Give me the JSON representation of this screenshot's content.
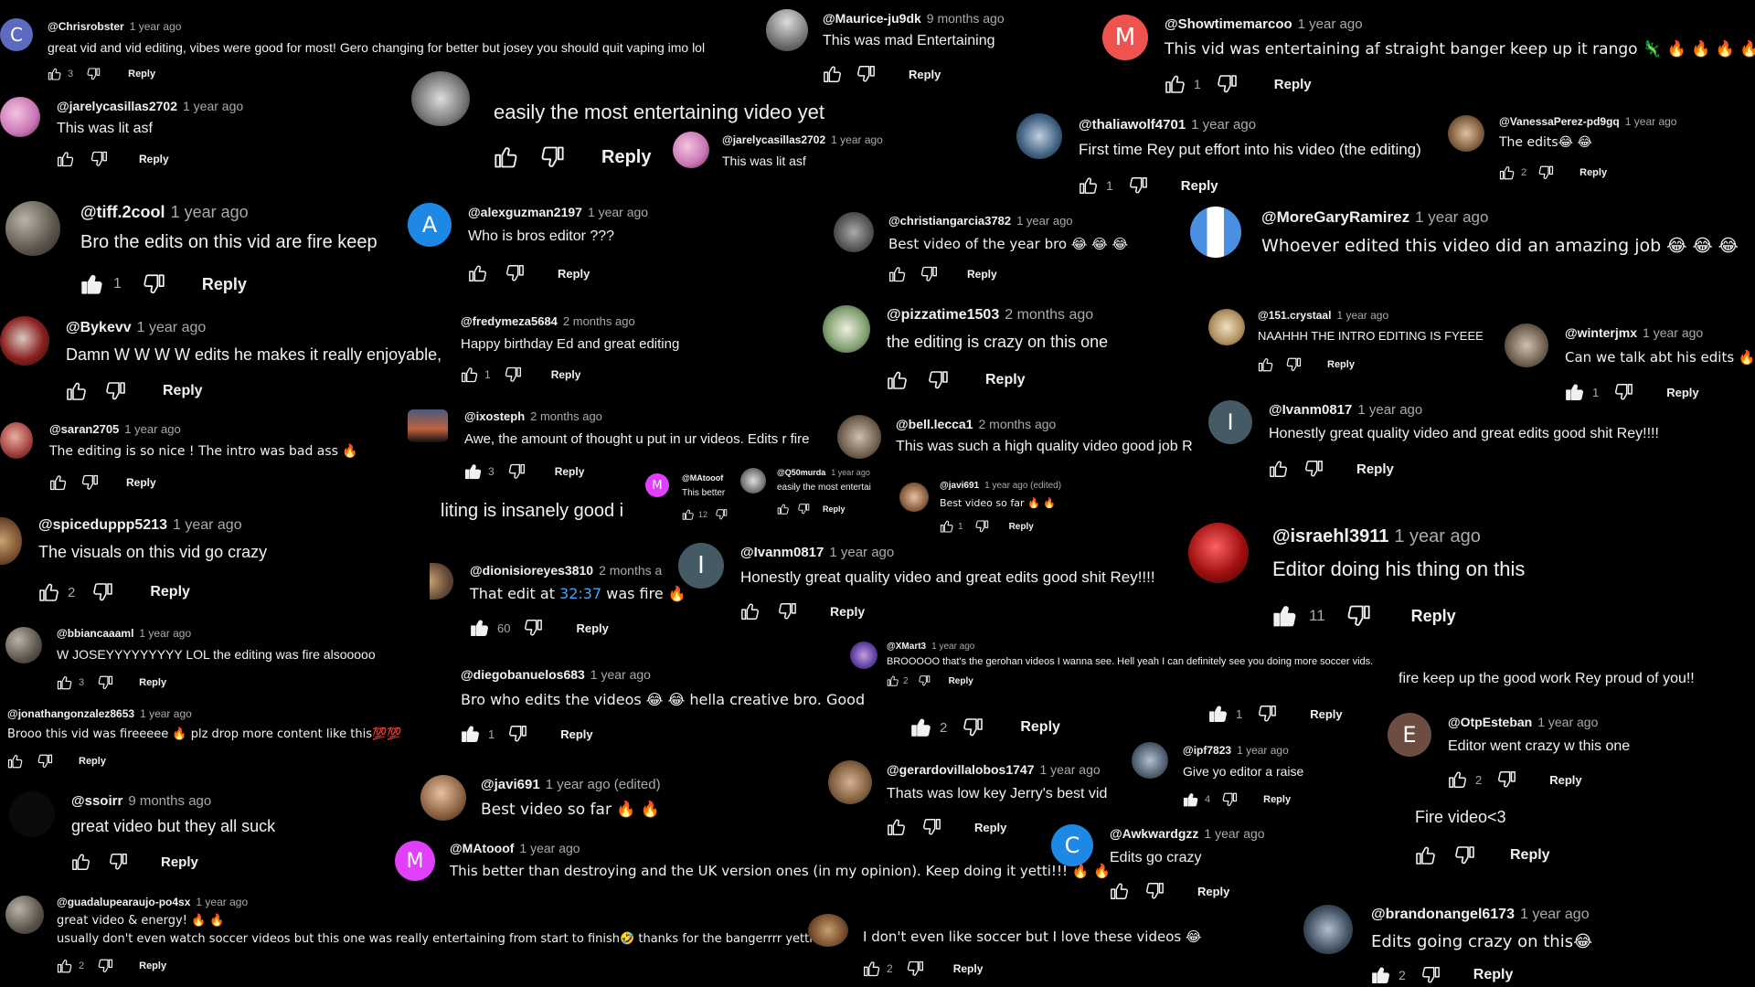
{
  "icons": {
    "like": "thumbs-up-icon",
    "dislike": "thumbs-down-icon"
  },
  "colors": {
    "background": "#000000",
    "username": "#f1f1f1",
    "timestamp": "#aaaaaa",
    "link": "#3ea6ff"
  },
  "comments": [
    {
      "id": "c1",
      "avatar_letter": "C",
      "user": "@Chrisrobster",
      "time": "1 year ago",
      "text": "great vid and vid editing, vibes were good for most! Gero changing for better but josey you should quit vaping imo lol",
      "likes": "3",
      "reply": "Reply"
    },
    {
      "id": "c2",
      "user": "@jarelycasillas2702",
      "time": "1 year ago",
      "text": "This was lit asf",
      "likes": "",
      "reply": "Reply"
    },
    {
      "id": "c3",
      "user": "@tiff.2cool",
      "time": "1 year ago",
      "text": "Bro the edits on this vid are fire keep",
      "likes": "1",
      "reply": "Reply"
    },
    {
      "id": "c4",
      "user": "@Bykevv",
      "time": "1 year ago",
      "text": "Damn W W W W edits he makes it really enjoyable,",
      "likes": "",
      "reply": "Reply"
    },
    {
      "id": "c5",
      "user": "@saran2705",
      "time": "1 year ago",
      "text": "The editing is so nice ! The intro was bad ass 🔥",
      "likes": "",
      "reply": "Reply"
    },
    {
      "id": "c6",
      "user": "@spiceduppp5213",
      "time": "1 year ago",
      "text": "The visuals on this vid go crazy",
      "likes": "2",
      "reply": "Reply"
    },
    {
      "id": "c7",
      "user": "@bbiancaaaml",
      "time": "1 year ago",
      "text": "W JOSEYYYYYYYYY LOL the editing was fire alsooooo",
      "likes": "3",
      "reply": "Reply"
    },
    {
      "id": "c8",
      "user": "@jonathangonzalez8653",
      "time": "1 year ago",
      "text": "Brooo this vid was fireeeee 🔥 plz drop more content like this💯💯",
      "likes": "",
      "reply": "Reply"
    },
    {
      "id": "c9",
      "user": "@ssoirr",
      "time": "9 months ago",
      "text": "great video but they all suck",
      "likes": "",
      "reply": "Reply"
    },
    {
      "id": "c10",
      "user": "@guadalupearaujo-po4sx",
      "time": "1 year ago",
      "text": "great video & energy! 🔥 🔥",
      "text2": "usually don't even watch soccer videos but this one was really entertaining from start to finish🤣 thanks for the bangerrrr yetti",
      "likes": "2",
      "reply": "Reply"
    },
    {
      "id": "c11",
      "text": "easily the most entertaining video yet",
      "likes": "",
      "reply": "Reply"
    },
    {
      "id": "c12",
      "user": "@jarelycasillas2702",
      "time": "1 year ago",
      "text": "This was lit asf"
    },
    {
      "id": "c13",
      "avatar_letter": "A",
      "user": "@alexguzman2197",
      "time": "1 year ago",
      "text": "Who is bros editor ???",
      "likes": "",
      "reply": "Reply"
    },
    {
      "id": "c14",
      "user": "@fredymeza5684",
      "time": "2 months ago",
      "text": "Happy birthday Ed and great editing",
      "likes": "1",
      "reply": "Reply"
    },
    {
      "id": "c15",
      "user": "@ixosteph",
      "time": "2 months ago",
      "text": "Awe, the amount of thought u put in ur videos. Edits r fire",
      "likes": "3",
      "reply": "Reply"
    },
    {
      "id": "c16",
      "avatar_letter": "M",
      "user": "@MAtooof",
      "text": "This better",
      "likes": "12"
    },
    {
      "id": "c17",
      "user": "@Q50murda",
      "time": "1 year ago",
      "text": "easily the most entertai",
      "likes": "",
      "reply": "Reply"
    },
    {
      "id": "c18",
      "text": "liting is insanely good i"
    },
    {
      "id": "c19",
      "user": "@dionisioreyes3810",
      "time": "2 months a",
      "text_before": "That edit at ",
      "link": "32:37",
      "text_after": " was fire 🔥",
      "likes": "60",
      "reply": "Reply"
    },
    {
      "id": "c20",
      "user": "@diegobanuelos683",
      "time": "1 year ago",
      "text": "Bro who edits the videos 😂 😂 hella creative bro. Good",
      "likes": "1",
      "reply": "Reply"
    },
    {
      "id": "c21",
      "user": "@javi691",
      "time": "1 year ago (edited)",
      "text": "Best video so far 🔥 🔥"
    },
    {
      "id": "c22",
      "avatar_letter": "M",
      "user": "@MAtooof",
      "time": "1 year ago",
      "text": "This better than destroying and the UK version ones (in my opinion). Keep doing it yetti!!! 🔥 🔥"
    },
    {
      "id": "c23",
      "user": "@Maurice-ju9dk",
      "time": "9 months ago",
      "text": "This was mad Entertaining",
      "likes": "",
      "reply": "Reply"
    },
    {
      "id": "c24",
      "user": "@christiangarcia3782",
      "time": "1 year ago",
      "text": "Best video of the year bro 😂 😂 😂",
      "likes": "",
      "reply": "Reply"
    },
    {
      "id": "c25",
      "user": "@pizzatime1503",
      "time": "2 months ago",
      "text": "the editing is crazy on this one",
      "likes": "",
      "reply": "Reply"
    },
    {
      "id": "c26",
      "user": "@bell.lecca1",
      "time": "2 months ago",
      "text": "This was such a high quality video good job R"
    },
    {
      "id": "c27",
      "user": "@javi691",
      "time": "1 year ago (edited)",
      "text": "Best video so far 🔥 🔥",
      "likes": "1",
      "reply": "Reply"
    },
    {
      "id": "c28",
      "avatar_letter": "I",
      "user": "@Ivanm0817",
      "time": "1 year ago",
      "text": "Honestly great quality video and great edits good shit Rey!!!!",
      "likes": "",
      "reply": "Reply"
    },
    {
      "id": "c29",
      "user": "@XMart3",
      "time": "1 year ago",
      "text": "BROOOOO that's the gerohan videos I wanna see. Hell yeah I can definitely see you doing more soccer vids.",
      "likes": "2",
      "reply": "Reply"
    },
    {
      "id": "c30",
      "likes": "2",
      "reply": "Reply"
    },
    {
      "id": "c31",
      "user": "@gerardovillalobos1747",
      "time": "1 year ago",
      "text": "Thats was low key Jerry's best vid",
      "likes": "",
      "reply": "Reply"
    },
    {
      "id": "c32",
      "text": "I don't even like soccer but I love these videos 😂",
      "likes": "2",
      "reply": "Reply"
    },
    {
      "id": "c33",
      "avatar_letter": "M",
      "user": "@Showtimemarcoo",
      "time": "1 year ago",
      "text": "This vid was entertaining af straight banger keep up it rango 🦎 🔥 🔥 🔥 🔥 🐐",
      "likes": "1",
      "reply": "Reply"
    },
    {
      "id": "c34",
      "user": "@thaliawolf4701",
      "time": "1 year ago",
      "text": "First time Rey put effort into his video (the editing)",
      "likes": "1",
      "reply": "Reply"
    },
    {
      "id": "c35",
      "user": "@VanessaPerez-pd9gq",
      "time": "1 year ago",
      "text": "The edits😂 😂",
      "likes": "2",
      "reply": "Reply"
    },
    {
      "id": "c36",
      "user": "@MoreGaryRamirez",
      "time": "1 year ago",
      "text": "Whoever edited this video did an amazing job 😂 😂 😂"
    },
    {
      "id": "c37",
      "user": "@151.crystaal",
      "time": "1 year ago",
      "text": "NAAHHH THE INTRO EDITING IS FYEEE",
      "likes": "",
      "reply": "Reply"
    },
    {
      "id": "c38",
      "user": "@winterjmx",
      "time": "1 year ago",
      "text": "Can we talk abt his edits 🔥",
      "likes": "1",
      "reply": "Reply"
    },
    {
      "id": "c39",
      "avatar_letter": "I",
      "user": "@Ivanm0817",
      "time": "1 year ago",
      "text": "Honestly great quality video and great edits good shit Rey!!!!",
      "likes": "",
      "reply": "Reply"
    },
    {
      "id": "c40",
      "user": "@israehl3911",
      "time": "1 year ago",
      "text": "Editor doing his thing on this",
      "likes": "11",
      "reply": "Reply"
    },
    {
      "id": "c41",
      "text": "fire keep up the good work Rey proud of you!!",
      "likes": "1",
      "reply": "Reply"
    },
    {
      "id": "c42",
      "avatar_letter": "E",
      "user": "@OtpEsteban",
      "time": "1 year ago",
      "text": "Editor went crazy w this one",
      "likes": "2",
      "reply": "Reply"
    },
    {
      "id": "c43",
      "text": "Fire video<3",
      "likes": "",
      "reply": "Reply"
    },
    {
      "id": "c44",
      "user": "@ipf7823",
      "time": "1 year ago",
      "text": "Give yo editor a raise",
      "likes": "4",
      "reply": "Reply"
    },
    {
      "id": "c45",
      "avatar_letter": "C",
      "user": "@Awkwardgzz",
      "time": "1 year ago",
      "text": "Edits go crazy",
      "likes": "",
      "reply": "Reply"
    },
    {
      "id": "c46",
      "user": "@brandonangel6173",
      "time": "1 year ago",
      "text": "Edits going crazy on this😂",
      "likes": "2",
      "reply": "Reply"
    }
  ]
}
